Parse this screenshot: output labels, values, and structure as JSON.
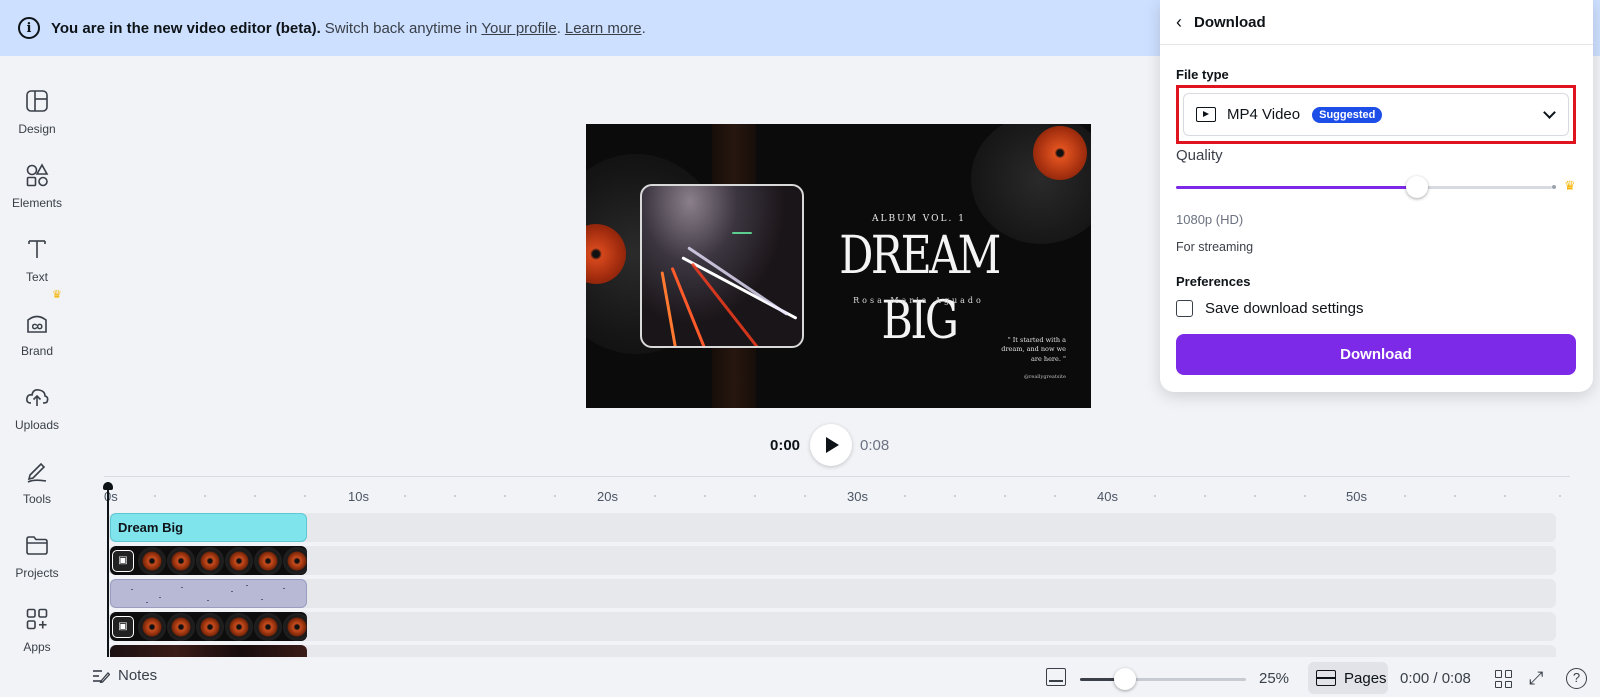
{
  "banner": {
    "bold": "You are in the new video editor (beta).",
    "plain": "Switch back anytime in",
    "link_profile": "Your profile",
    "link_learn": "Learn more"
  },
  "rail": [
    {
      "label": "Design",
      "icon": "layout-icon"
    },
    {
      "label": "Elements",
      "icon": "shapes-icon"
    },
    {
      "label": "Text",
      "icon": "text-icon"
    },
    {
      "label": "Brand",
      "icon": "brand-icon"
    },
    {
      "label": "Uploads",
      "icon": "cloud-upload-icon"
    },
    {
      "label": "Tools",
      "icon": "pen-icon"
    },
    {
      "label": "Projects",
      "icon": "folder-icon"
    },
    {
      "label": "Apps",
      "icon": "apps-icon"
    }
  ],
  "canvas": {
    "album_tag": "ALBUM VOL. 1",
    "title": "DREAM BIG",
    "artist": "Rosa Maria Aguado",
    "quote": "\" It started with a dream, and now we are here. \"",
    "handle": "@reallygreatsite"
  },
  "playback": {
    "current": "0:00",
    "total": "0:08"
  },
  "timeline": {
    "ticks": [
      "0s",
      "10s",
      "20s",
      "30s",
      "40s",
      "50s"
    ],
    "text_clip": "Dream Big"
  },
  "bottom": {
    "notes": "Notes",
    "zoom": "25%",
    "zoom_level": 0.27,
    "pages": "Pages",
    "time": "0:00 / 0:08"
  },
  "panel": {
    "title": "Download",
    "file_type_label": "File type",
    "file_type_value": "MP4 Video",
    "badge": "Suggested",
    "quality_label": "Quality",
    "quality_level": 0.64,
    "resolution": "1080p (HD)",
    "note": "For streaming",
    "preferences_label": "Preferences",
    "save_settings": "Save download settings",
    "download_button": "Download"
  },
  "colors": {
    "accent": "#7d2ae8",
    "badge": "#1d4ee8",
    "highlight": "#e0141e",
    "banner": "#cde0ff"
  }
}
